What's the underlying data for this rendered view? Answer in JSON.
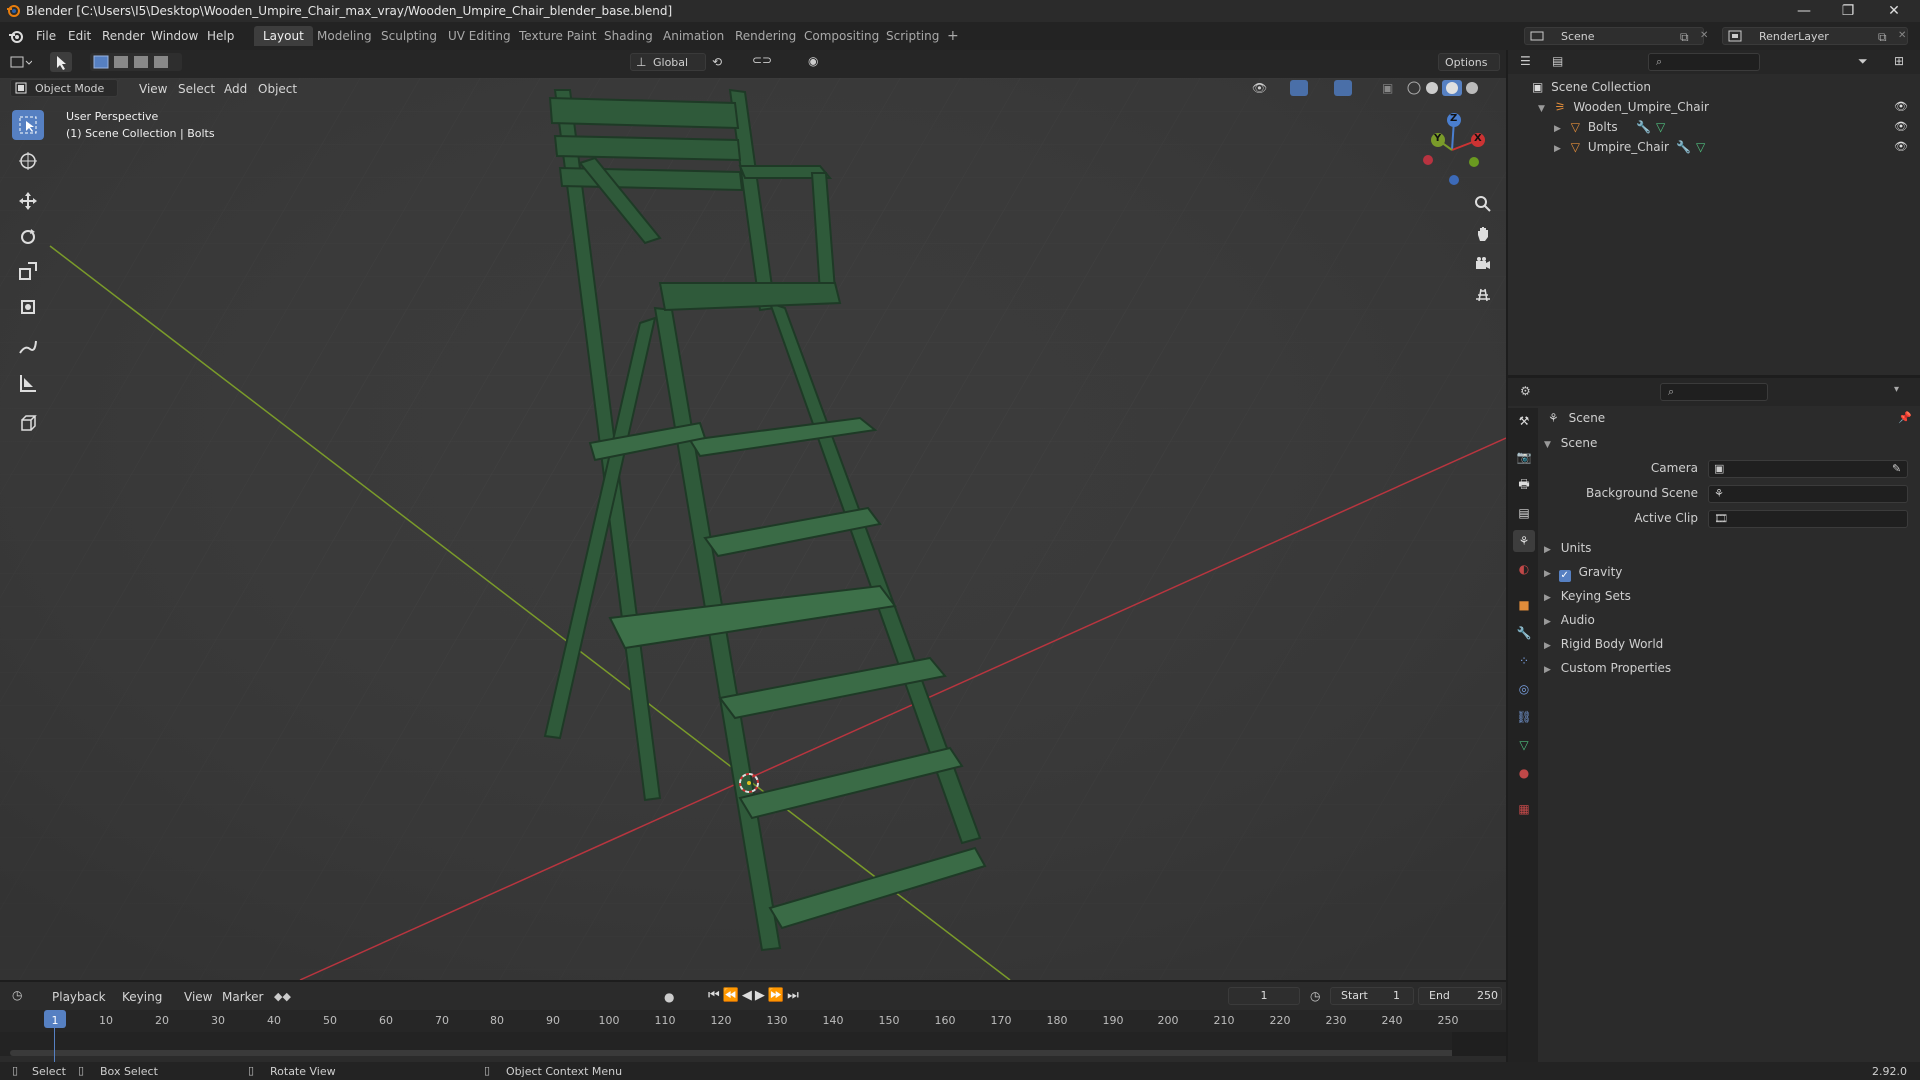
{
  "window": {
    "title": "Blender [C:\\Users\\I5\\Desktop\\Wooden_Umpire_Chair_max_vray/Wooden_Umpire_Chair_blender_base.blend]",
    "minimize": "—",
    "maximize": "❐",
    "close": "✕"
  },
  "menu": {
    "items": [
      "File",
      "Edit",
      "Render",
      "Window",
      "Help"
    ]
  },
  "workspaces": {
    "tabs": [
      "Layout",
      "Modeling",
      "Sculpting",
      "UV Editing",
      "Texture Paint",
      "Shading",
      "Animation",
      "Rendering",
      "Compositing",
      "Scripting"
    ],
    "active": "Layout",
    "add_symbol": "+"
  },
  "topbar_right": {
    "scene_name": "Scene",
    "view_layer": "RenderLayer"
  },
  "viewport_header": {
    "mode": "Object Mode",
    "menus": [
      "View",
      "Select",
      "Add",
      "Object"
    ],
    "transform_orientation": "Global",
    "options_label": "Options"
  },
  "viewport_overlay": {
    "perspective_label": "User Perspective",
    "collection_label": "(1) Scene Collection | Bolts"
  },
  "gizmo": {
    "axis_x": "X",
    "axis_y": "Y",
    "axis_z": "Z"
  },
  "outliner": {
    "root": "Scene Collection",
    "collection": "Wooden_Umpire_Chair",
    "objects": [
      "Bolts",
      "Umpire_Chair"
    ]
  },
  "properties": {
    "context_label": "Scene",
    "panel_title": "Scene",
    "fields": [
      {
        "label": "Camera",
        "value": ""
      },
      {
        "label": "Background Scene",
        "value": ""
      },
      {
        "label": "Active Clip",
        "value": ""
      }
    ],
    "subpanels": [
      "Units",
      "Gravity",
      "Keying Sets",
      "Audio",
      "Rigid Body World",
      "Custom Properties"
    ],
    "gravity_enabled": true
  },
  "timeline": {
    "menus": [
      "Playback",
      "Keying",
      "View",
      "Marker"
    ],
    "current_frame": "1",
    "start_label": "Start",
    "start_value": "1",
    "end_label": "End",
    "end_value": "250",
    "ticks": [
      "1",
      "10",
      "20",
      "30",
      "40",
      "50",
      "60",
      "70",
      "80",
      "90",
      "100",
      "110",
      "120",
      "130",
      "140",
      "150",
      "160",
      "170",
      "180",
      "190",
      "200",
      "210",
      "220",
      "230",
      "240",
      "250"
    ]
  },
  "statusbar": {
    "select": "Select",
    "box_select": "Box Select",
    "rotate_view": "Rotate View",
    "context_menu": "Object Context Menu",
    "version": "2.92.0"
  },
  "colors": {
    "accent_blue": "#5680c2",
    "axis_red": "#b8353f",
    "axis_green": "#7a9b2a",
    "chair_green": "#2f5a3a",
    "viewport_bg": "#3b3b3b"
  }
}
